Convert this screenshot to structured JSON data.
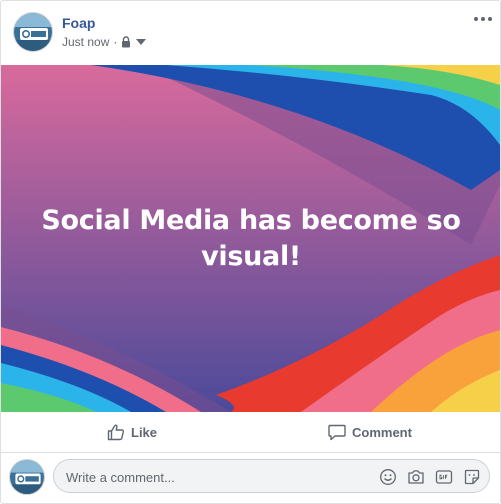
{
  "post": {
    "author": "Foap",
    "timestamp": "Just now",
    "separator": "·",
    "privacy_icon": "lock-icon",
    "audience_icon": "caret-down-icon",
    "options_icon": "more-options-icon"
  },
  "banner": {
    "text": "Social Media has become so visual!",
    "colors": {
      "background_top": "#d96a9c",
      "background_bottom": "#4b4a9a",
      "stripe_colors": [
        "#e83a2e",
        "#f06e8a",
        "#f9a13a",
        "#f7d04a",
        "#5cc96f",
        "#2bb4ea",
        "#1e4fae"
      ]
    }
  },
  "actions": {
    "like_label": "Like",
    "comment_label": "Comment"
  },
  "composer": {
    "placeholder": "Write a comment...",
    "tools": [
      "emoji-icon",
      "camera-icon",
      "gif-icon",
      "sticker-icon"
    ]
  },
  "brand": {
    "link_color": "#365899",
    "muted_color": "#606770"
  }
}
